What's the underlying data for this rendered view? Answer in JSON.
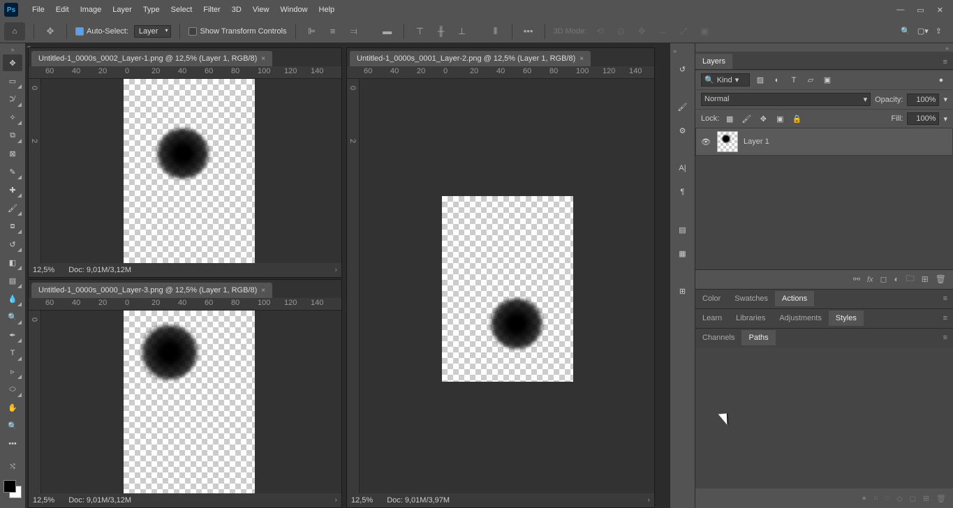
{
  "menu": [
    "File",
    "Edit",
    "Image",
    "Layer",
    "Type",
    "Select",
    "Filter",
    "3D",
    "View",
    "Window",
    "Help"
  ],
  "options": {
    "autoSelect": "Auto-Select:",
    "layerDropdown": "Layer",
    "showTransform": "Show Transform Controls",
    "mode3d": "3D Mode:"
  },
  "docs": [
    {
      "title": "Untitled-1_0000s_0002_Layer-1.png @ 12,5% (Layer 1, RGB/8)",
      "zoom": "12,5%",
      "docInfo": "Doc: 9,01M/3,12M"
    },
    {
      "title": "Untitled-1_0000s_0001_Layer-2.png @ 12,5% (Layer 1, RGB/8)",
      "zoom": "12,5%",
      "docInfo": "Doc: 9,01M/3,97M"
    },
    {
      "title": "Untitled-1_0000s_0000_Layer-3.png @ 12,5% (Layer 1, RGB/8)",
      "zoom": "12,5%",
      "docInfo": "Doc: 9,01M/3,12M"
    }
  ],
  "rulerH": [
    "60",
    "40",
    "20",
    "0",
    "20",
    "40",
    "60",
    "80",
    "100",
    "120",
    "140"
  ],
  "layers": {
    "panel": "Layers",
    "kind": "Kind",
    "blend": "Normal",
    "opacityLabel": "Opacity:",
    "opacity": "100%",
    "lockLabel": "Lock:",
    "fillLabel": "Fill:",
    "fill": "100%",
    "layerName": "Layer 1"
  },
  "groups1": [
    "Color",
    "Swatches",
    "Actions"
  ],
  "groups2": [
    "Learn",
    "Libraries",
    "Adjustments",
    "Styles"
  ],
  "groups3": [
    "Channels",
    "Paths"
  ]
}
